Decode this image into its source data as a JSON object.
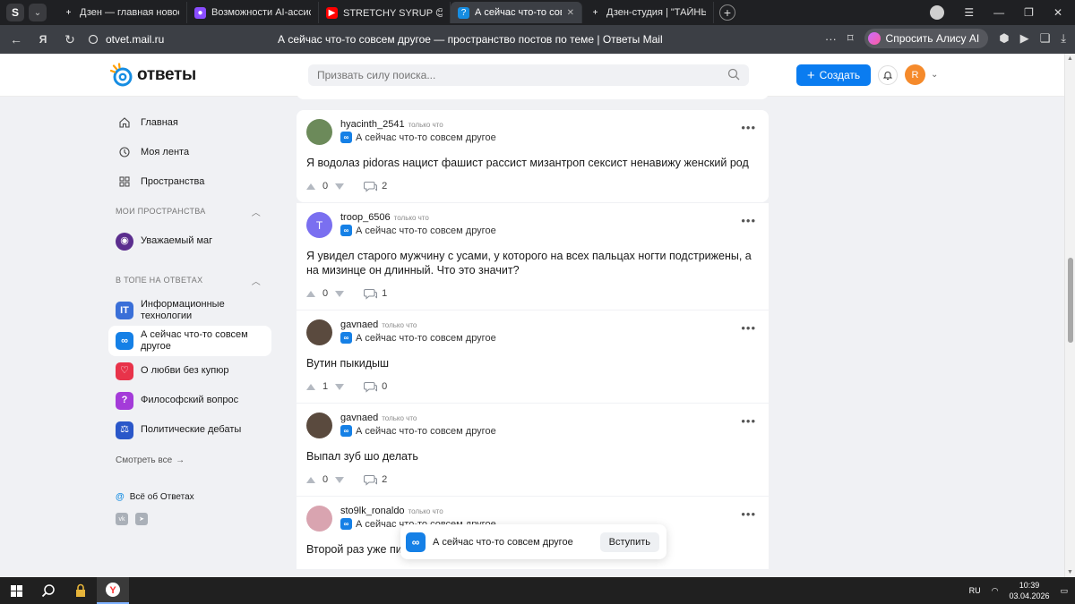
{
  "browser": {
    "tabs": [
      {
        "title": "Дзен — главная новостна",
        "icon_color": "#ffffff",
        "icon": "+",
        "active": false
      },
      {
        "title": "Возможности AI-ассисте",
        "icon_color": "#8a4dff",
        "icon": "●",
        "active": false
      },
      {
        "title": "STRETCHY SYRUP 😊 flow",
        "icon_color": "#ff0000",
        "icon": "▶",
        "active": false
      },
      {
        "title": "А сейчас что-то совсем",
        "icon_color": "#168de2",
        "icon": "?",
        "active": true
      },
      {
        "title": "Дзен-студия | \"ТАЙНЫ М",
        "icon_color": "#ffffff",
        "icon": "+",
        "active": false
      }
    ],
    "url": "otvet.mail.ru",
    "page_title": "А сейчас что-то совсем другое — пространство постов по теме | Ответы Mail",
    "alice_label": "Спросить Алису AI"
  },
  "header": {
    "logo_text": "ответы",
    "search_placeholder": "Призвать силу поиска...",
    "create_label": "Создать",
    "avatar_letter": "R"
  },
  "sidebar": {
    "nav": [
      {
        "label": "Главная",
        "icon": "home-icon"
      },
      {
        "label": "Моя лента",
        "icon": "feed-icon"
      },
      {
        "label": "Пространства",
        "icon": "spaces-icon"
      }
    ],
    "my_spaces_title": "МОИ ПРОСТРАНСТВА",
    "my_spaces": [
      {
        "label": "Уважаемый маг",
        "color": "#5b2d8e",
        "glyph": "◉"
      }
    ],
    "top_title": "В ТОПЕ НА ОТВЕТАХ",
    "top_spaces": [
      {
        "label": "Информационные технологии",
        "color": "#3a6fd8",
        "glyph": "IT",
        "active": false
      },
      {
        "label": "А сейчас что-то совсем другое",
        "color": "#1580e6",
        "glyph": "∞",
        "active": true
      },
      {
        "label": "О любви без купюр",
        "color": "#e8334a",
        "glyph": "♡",
        "active": false
      },
      {
        "label": "Философский вопрос",
        "color": "#a43bd9",
        "glyph": "?",
        "active": false
      },
      {
        "label": "Политические дебаты",
        "color": "#2a57c9",
        "glyph": "⚖",
        "active": false
      }
    ],
    "see_all": "Смотреть все",
    "about": "Всё об Ответах"
  },
  "posts": [
    {
      "author": "hyacinth_2541",
      "time": "только что",
      "space": "А сейчас что-то совсем другое",
      "text": "Я водолаз pidoras нацист фашист рассист мизантроп сексист ненавижу женский род",
      "votes": "0",
      "comments": "2",
      "avatar_color": "#6c8a5a",
      "avatar_letter": ""
    },
    {
      "author": "troop_6506",
      "time": "только что",
      "space": "А сейчас что-то совсем другое",
      "text": "Я увидел старого мужчину с усами, у которого на всех пальцах ногти подстрижены, а на мизинце он длинный. Что это значит?",
      "votes": "0",
      "comments": "1",
      "avatar_color": "#7a6ff0",
      "avatar_letter": "T"
    },
    {
      "author": "gavnaed",
      "time": "только что",
      "space": "А сейчас что-то совсем другое",
      "text": "Вутин пыкидыш",
      "votes": "1",
      "comments": "0",
      "avatar_color": "#5a4a3e",
      "avatar_letter": ""
    },
    {
      "author": "gavnaed",
      "time": "только что",
      "space": "А сейчас что-то совсем другое",
      "text": "Выпал зуб шо делать",
      "votes": "0",
      "comments": "2",
      "avatar_color": "#5a4a3e",
      "avatar_letter": ""
    },
    {
      "author": "sto9lk_ronaldo",
      "time": "только что",
      "space": "А сейчас что-то совсем другое",
      "text": "Второй раз уже пидорас?",
      "votes": "",
      "comments": "",
      "avatar_color": "#d9a4b0",
      "avatar_letter": ""
    }
  ],
  "toast": {
    "space": "А сейчас что-то совсем другое",
    "join_label": "Вступить"
  },
  "taskbar": {
    "lang": "RU",
    "time": "10:39",
    "date": "03.04.2026"
  }
}
